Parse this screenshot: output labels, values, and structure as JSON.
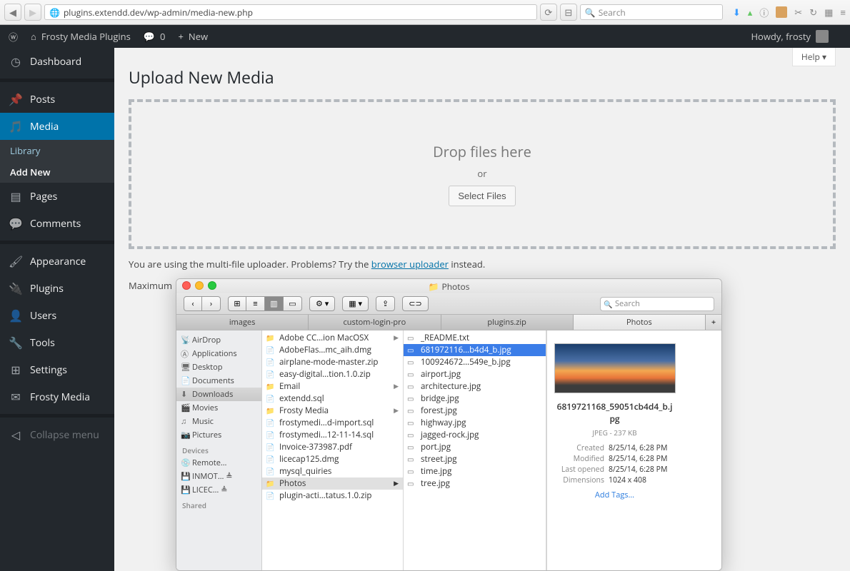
{
  "browser": {
    "url": "plugins.extendd.dev/wp-admin/media-new.php",
    "search_placeholder": "Search"
  },
  "adminbar": {
    "site_title": "Frosty Media Plugins",
    "comments": "0",
    "new": "New",
    "howdy": "Howdy, frosty"
  },
  "sidebar": {
    "items": [
      {
        "label": "Dashboard",
        "icon": "◷"
      },
      {
        "label": "Posts",
        "icon": "📌"
      },
      {
        "label": "Media",
        "icon": "🖼"
      },
      {
        "label": "Pages",
        "icon": "▤"
      },
      {
        "label": "Comments",
        "icon": "💬"
      },
      {
        "label": "Appearance",
        "icon": "🖌"
      },
      {
        "label": "Plugins",
        "icon": "🔌"
      },
      {
        "label": "Users",
        "icon": "👤"
      },
      {
        "label": "Tools",
        "icon": "🔧"
      },
      {
        "label": "Settings",
        "icon": "⚙"
      },
      {
        "label": "Frosty Media",
        "icon": "✉"
      },
      {
        "label": "Collapse menu",
        "icon": "◁"
      }
    ],
    "submenu": {
      "library": "Library",
      "add_new": "Add New"
    }
  },
  "main": {
    "help": "Help ▾",
    "title": "Upload New Media",
    "drop_here": "Drop files here",
    "or": "or",
    "select_files": "Select Files",
    "note_pre": "You are using the multi-file uploader. Problems? Try the ",
    "note_link": "browser uploader",
    "note_post": " instead.",
    "maximum": "Maximum"
  },
  "finder": {
    "title": "Photos",
    "search_placeholder": "Search",
    "tabs": [
      "images",
      "custom-login-pro",
      "plugins.zip",
      "Photos"
    ],
    "sb": {
      "airdrop": "AirDrop",
      "applications": "Applications",
      "desktop": "Desktop",
      "documents": "Documents",
      "downloads": "Downloads",
      "movies": "Movies",
      "music": "Music",
      "pictures": "Pictures",
      "devices_head": "Devices",
      "remote": "Remote…",
      "inmot": "INMOT… ≜",
      "licec": "LICEC… ≜",
      "shared_head": "Shared"
    },
    "col1": [
      {
        "name": "Adobe CC…ion MacOSX",
        "folder": true,
        "chev": true
      },
      {
        "name": "AdobeFlas…mc_aih.dmg"
      },
      {
        "name": "airplane-mode-master.zip"
      },
      {
        "name": "easy-digital…tion.1.0.zip"
      },
      {
        "name": "Email",
        "folder": true,
        "chev": true
      },
      {
        "name": "extendd.sql"
      },
      {
        "name": "Frosty Media",
        "folder": true,
        "chev": true
      },
      {
        "name": "frostymedi…d-import.sql"
      },
      {
        "name": "frostymedi…12-11-14.sql"
      },
      {
        "name": "Invoice-373987.pdf"
      },
      {
        "name": "licecap125.dmg"
      },
      {
        "name": "mysql_quiries"
      },
      {
        "name": "Photos",
        "folder": true,
        "chev": true,
        "selected": true
      },
      {
        "name": "plugin-acti…tatus.1.0.zip"
      }
    ],
    "col2": [
      {
        "name": "_README.txt"
      },
      {
        "name": "681972116…b4d4_b.jpg",
        "hl": true
      },
      {
        "name": "100924672…549e_b.jpg"
      },
      {
        "name": "airport.jpg"
      },
      {
        "name": "architecture.jpg"
      },
      {
        "name": "bridge.jpg"
      },
      {
        "name": "forest.jpg"
      },
      {
        "name": "highway.jpg"
      },
      {
        "name": "jagged-rock.jpg"
      },
      {
        "name": "port.jpg"
      },
      {
        "name": "street.jpg"
      },
      {
        "name": "time.jpg"
      },
      {
        "name": "tree.jpg"
      }
    ],
    "preview": {
      "filename": "6819721168_59051cb4d4_b.jpg",
      "kind": "JPEG - 237 KB",
      "created_k": "Created",
      "created_v": "8/25/14, 6:28 PM",
      "modified_k": "Modified",
      "modified_v": "8/25/14, 6:28 PM",
      "opened_k": "Last opened",
      "opened_v": "8/25/14, 6:28 PM",
      "dim_k": "Dimensions",
      "dim_v": "1024 x 408",
      "add_tags": "Add Tags…"
    }
  }
}
